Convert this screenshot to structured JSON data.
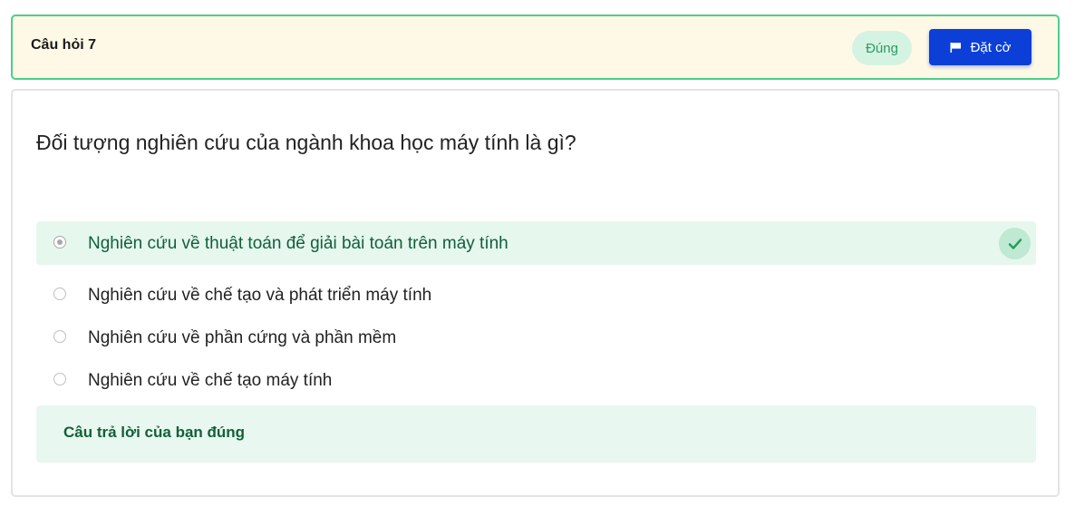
{
  "header": {
    "title": "Câu hỏi 7",
    "status_badge": "Đúng",
    "flag_button_label": "Đặt cờ",
    "flag_icon": "flag-icon"
  },
  "question": {
    "text": "Đối tượng nghiên cứu của ngành khoa học máy tính là gì?",
    "options": [
      {
        "label": "Nghiên cứu về thuật toán để giải bài toán trên máy tính",
        "selected": true,
        "correct": true
      },
      {
        "label": "Nghiên cứu về chế tạo và phát triển máy tính",
        "selected": false,
        "correct": false
      },
      {
        "label": "Nghiên cứu về phần cứng và phần mềm",
        "selected": false,
        "correct": false
      },
      {
        "label": "Nghiên cứu về chế tạo máy tính",
        "selected": false,
        "correct": false
      }
    ],
    "correct_icon": "check-icon"
  },
  "feedback": {
    "text": "Câu trả lời của bạn đúng"
  },
  "colors": {
    "accent": "#0c3fd8",
    "success": "#2c9c64",
    "success_bg": "#e6f7ee",
    "header_bg": "#fef9e6",
    "header_border": "#4ccf8c"
  }
}
